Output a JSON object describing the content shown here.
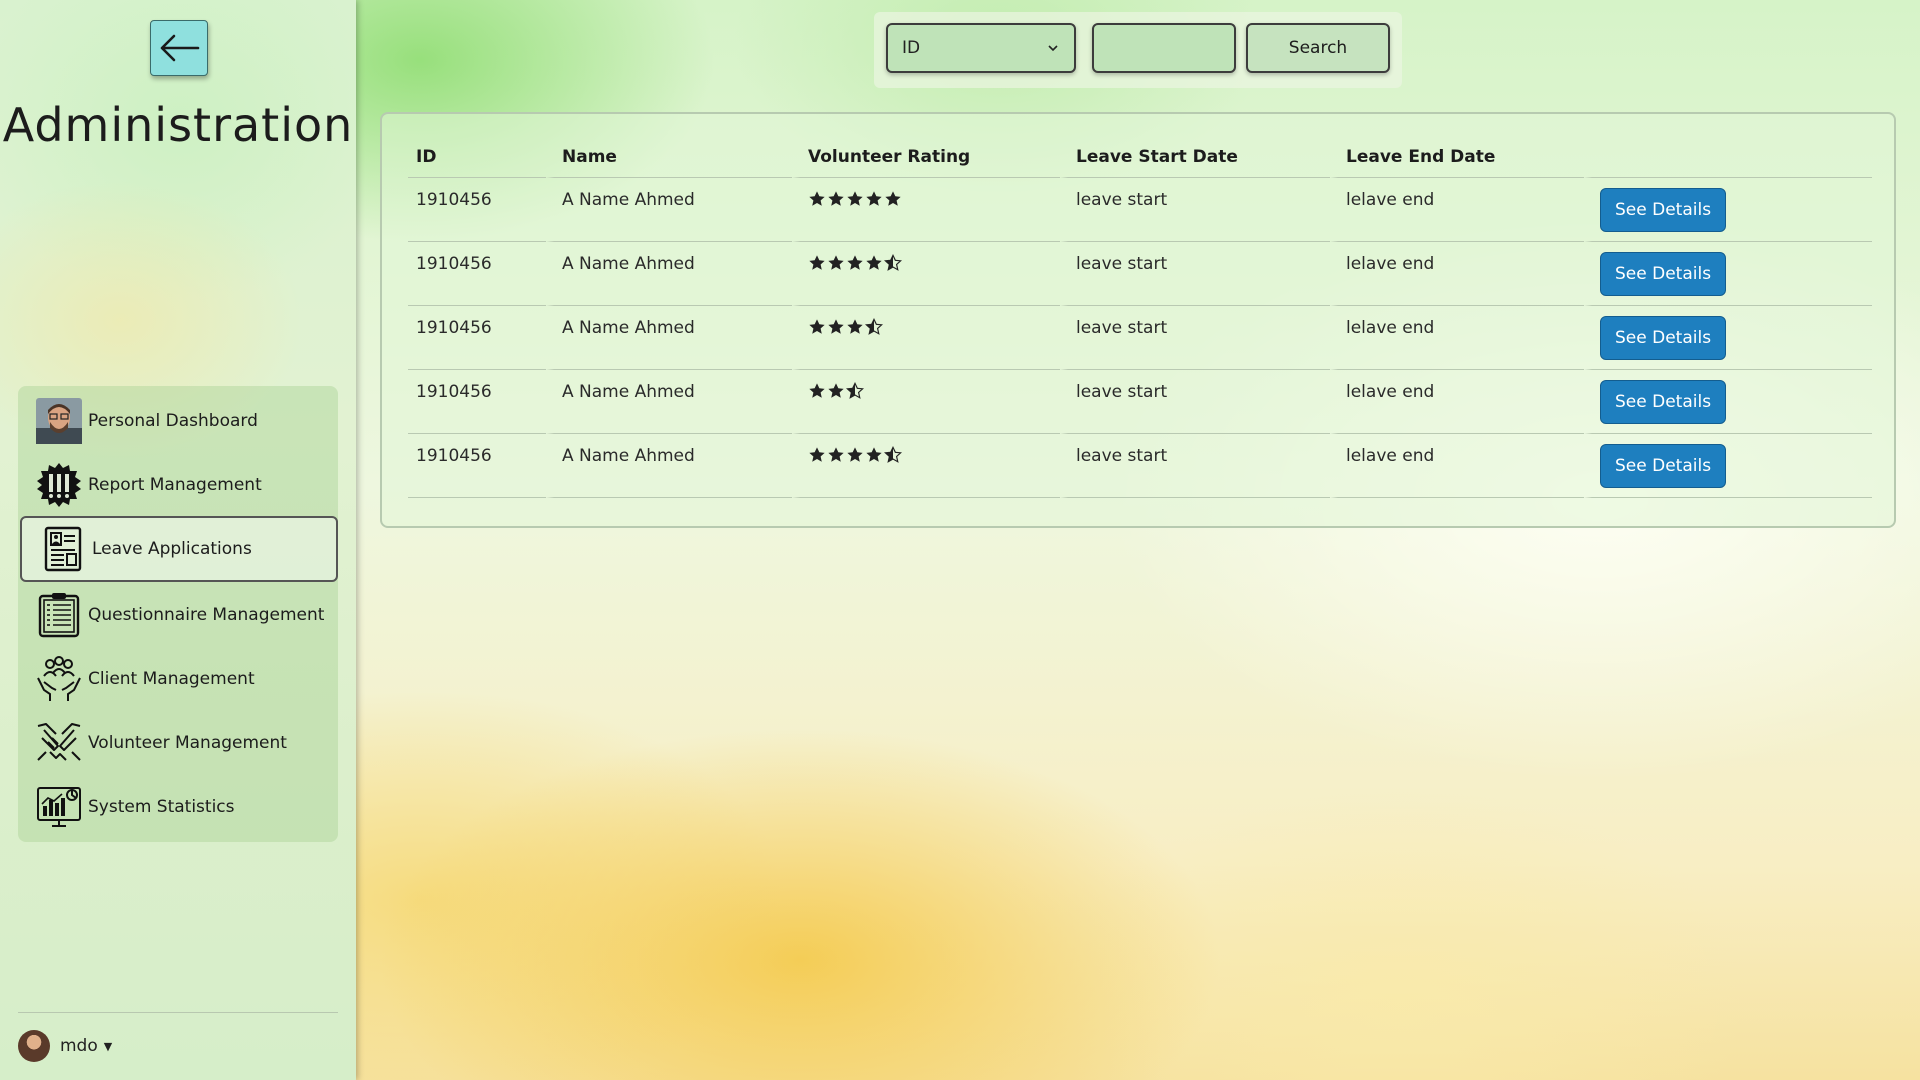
{
  "sidebar": {
    "back_icon": "arrow-left-icon",
    "title": "Administration",
    "items": [
      {
        "label": "Personal Dashboard",
        "icon": "user-photo-icon",
        "active": false
      },
      {
        "label": "Report Management",
        "icon": "report-badge-icon",
        "active": false
      },
      {
        "label": "Leave Applications",
        "icon": "document-icon",
        "active": true
      },
      {
        "label": "Questionnaire Management",
        "icon": "clipboard-list-icon",
        "active": false
      },
      {
        "label": "Client Management",
        "icon": "people-hands-icon",
        "active": false
      },
      {
        "label": "Volunteer Management",
        "icon": "handshake-icon",
        "active": false
      },
      {
        "label": "System Statistics",
        "icon": "stats-monitor-icon",
        "active": false
      }
    ],
    "user": {
      "name": "mdo"
    }
  },
  "search": {
    "filter_value": "ID",
    "input_value": "",
    "button_label": "Search"
  },
  "table": {
    "headers": [
      "ID",
      "Name",
      "Volunteer Rating",
      "Leave Start Date",
      "Leave End Date",
      ""
    ],
    "rows": [
      {
        "id": "1910456",
        "name": "A Name Ahmed",
        "rating": 5,
        "start": "leave start",
        "end": "lelave end",
        "action": "See Details"
      },
      {
        "id": "1910456",
        "name": "A Name Ahmed",
        "rating": 4.5,
        "start": "leave start",
        "end": "lelave end",
        "action": "See Details"
      },
      {
        "id": "1910456",
        "name": "A Name Ahmed",
        "rating": 3.5,
        "start": "leave start",
        "end": "lelave end",
        "action": "See Details"
      },
      {
        "id": "1910456",
        "name": "A Name Ahmed",
        "rating": 2.5,
        "start": "leave start",
        "end": "lelave end",
        "action": "See Details"
      },
      {
        "id": "1910456",
        "name": "A Name Ahmed",
        "rating": 4.5,
        "start": "leave start",
        "end": "lelave end",
        "action": "See Details"
      }
    ]
  },
  "colors": {
    "accent": "#1e7fbf",
    "back_button": "#8fe0de"
  }
}
